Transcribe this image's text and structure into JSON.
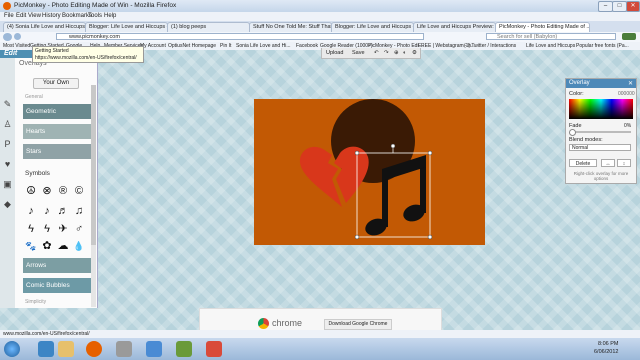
{
  "window": {
    "title": "PicMonkey - Photo Editing Made of Win - Mozilla Firefox",
    "controls": [
      "–",
      "□",
      "✕"
    ]
  },
  "menu": [
    "File",
    "Edit",
    "View",
    "History",
    "Bookmarks",
    "Tools",
    "Help"
  ],
  "tabs": [
    "(4) Sonia Life Love and Hiccups - Sam...",
    "Blogger: Life Love and Hiccups - Crea...",
    "(1) blog peeps",
    "Stuff No One Told Me: Stuff That...",
    "Blogger: Life Love and Hiccups - Edit...",
    "Life Love and Hiccups Preview: S'mor...",
    "PicMonkey - Photo Editing Made of ..."
  ],
  "nav": {
    "url": "www.picmonkey.com",
    "search_placeholder": "Search for sell (Babylon)"
  },
  "bookmarks": [
    "Most Visited",
    "Getting Started",
    "Google",
    "Help",
    "Member Services",
    "My Account",
    "OptiusNet Homepage",
    "Pin It",
    "Sonia Life Love and Hi...",
    "Facebook",
    "Google Reader (1000+)",
    "PicMonkey - Photo Edi...",
    "FREE | Webstagram - h...",
    "(1) Twitter / Interactions",
    "Life Love and Hiccups",
    "Popular free fonts (Pa..."
  ],
  "tooltip": {
    "title": "Getting Started",
    "url": "https://www.mozilla.com/en-US/firefox/central/"
  },
  "editor": {
    "logo": "Edit",
    "panel_title": "Overlays",
    "your_own": "Your Own",
    "section_general": "General",
    "categories_top": [
      "Geometric",
      "Hearts",
      "Stars"
    ],
    "symbols_label": "Symbols",
    "symbol_rows": [
      [
        "☮",
        "⊗",
        "®",
        "©"
      ],
      [
        "♪",
        "♪",
        "♬",
        "♫"
      ],
      [
        "ϟ",
        "ϟ",
        "✈",
        "♂"
      ],
      [
        "🐾",
        "✿",
        "☁",
        "💧"
      ]
    ],
    "categories_bottom": [
      "Arrows",
      "Comic Bubbles"
    ],
    "section_simplicity": "Simplicity",
    "rail_icons": [
      "effects-icon",
      "touchup-icon",
      "text-icon",
      "overlays-icon",
      "frames-icon",
      "textures-icon"
    ]
  },
  "toolbar": {
    "undo_upload": "Upload",
    "save": "Save",
    "icons": [
      "undo-icon",
      "redo-icon",
      "zoom-icon",
      "rotate-icon",
      "settings-icon"
    ]
  },
  "overlay_panel": {
    "title": "Overlay",
    "color_label": "Color:",
    "color_hex": "000000",
    "fade_label": "Fade",
    "fade_value": "0%",
    "blend_label": "Blend modes:",
    "blend_value": "Normal",
    "delete": "Delete",
    "hint": "Right-click overlay for more options"
  },
  "colors": {
    "canvas_bg": "#c25904",
    "circle": "#3a1a05",
    "heart": "#d8371b",
    "note": "#111111",
    "accent": "#4d89b8"
  },
  "ad": {
    "brand": "chrome",
    "button": "Download Google Chrome"
  },
  "status_url": "www.mozilla.com/en-US/firefox/central/",
  "taskbar": {
    "time": "8:06 PM",
    "date": "6/06/2012"
  }
}
